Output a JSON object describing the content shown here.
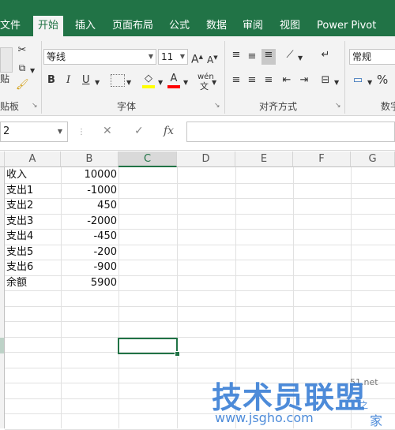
{
  "ribbon": {
    "tabs": [
      "文件",
      "开始",
      "插入",
      "页面布局",
      "公式",
      "数据",
      "审阅",
      "视图",
      "Power Pivot"
    ],
    "active_tab": "开始",
    "clipboard": {
      "paste_label": "贴",
      "group_label": "贴板"
    },
    "font": {
      "name": "等线",
      "size": "11",
      "group_label": "字体",
      "bold": "B",
      "italic": "I",
      "underline": "U",
      "phonetic": "wén"
    },
    "alignment": {
      "group_label": "对齐方式"
    },
    "number": {
      "format": "常规",
      "group_label": "数字",
      "percent": "%"
    }
  },
  "formula_bar": {
    "name_box": "2",
    "cancel": "✕",
    "enter": "✓",
    "fx": "fx",
    "formula": ""
  },
  "grid": {
    "columns": [
      "A",
      "B",
      "C",
      "D",
      "E",
      "F",
      "G"
    ],
    "selected_column": "C",
    "rows": [
      {
        "a": "收入",
        "b": "10000"
      },
      {
        "a": "支出1",
        "b": "-1000"
      },
      {
        "a": "支出2",
        "b": "450"
      },
      {
        "a": "支出3",
        "b": "-2000"
      },
      {
        "a": "支出4",
        "b": "-450"
      },
      {
        "a": "支出5",
        "b": "-200"
      },
      {
        "a": "支出6",
        "b": "-900"
      },
      {
        "a": "余额",
        "b": "5900"
      }
    ]
  },
  "watermark": {
    "title": "技术员联盟",
    "url": "www.jsgho.com",
    "site": "家",
    "small": "之",
    "net": "51.net"
  },
  "colors": {
    "accent": "#217346",
    "watermark": "#3a7fd5"
  }
}
